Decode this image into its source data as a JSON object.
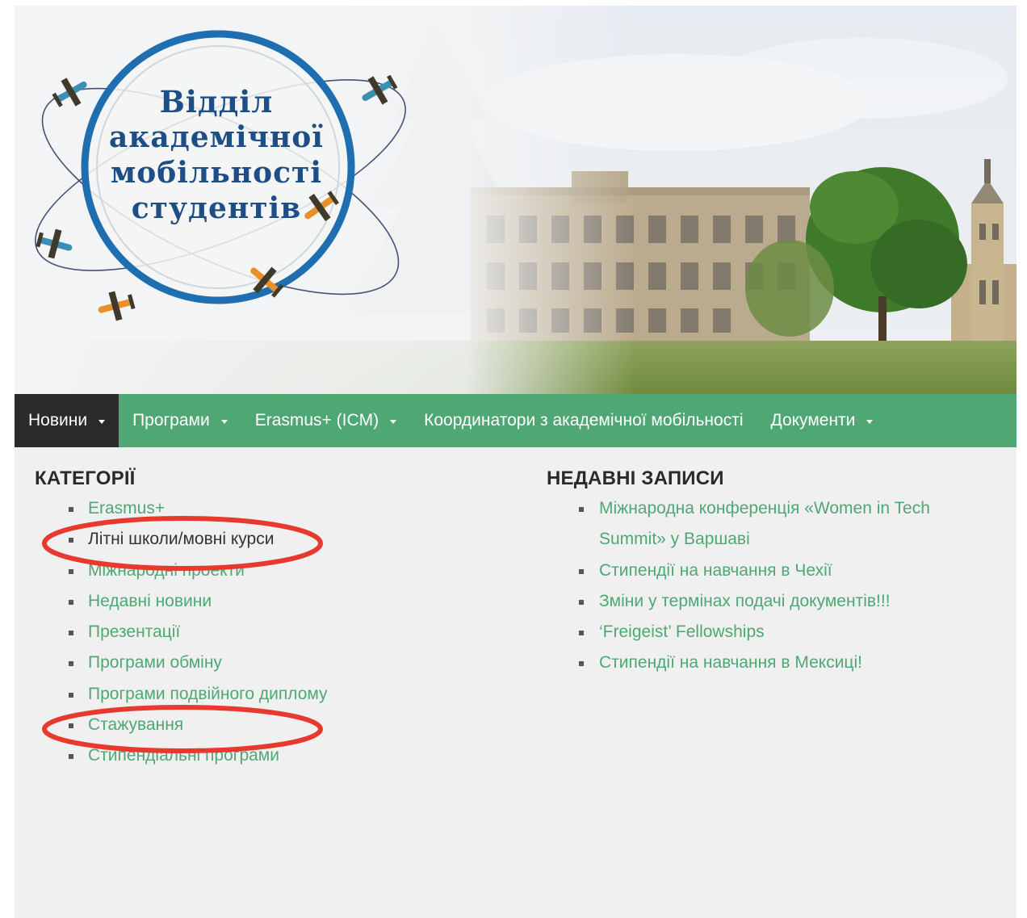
{
  "header": {
    "logo_lines": [
      "Відділ",
      "академічної",
      "мобільності",
      "студентів"
    ]
  },
  "nav": {
    "items": [
      {
        "label": "Новини",
        "has_dropdown": true,
        "active": true
      },
      {
        "label": "Програми",
        "has_dropdown": true,
        "active": false
      },
      {
        "label": "Erasmus+ (ICM)",
        "has_dropdown": true,
        "active": false
      },
      {
        "label": "Координатори з академічної мобільності",
        "has_dropdown": false,
        "active": false
      },
      {
        "label": "Документи",
        "has_dropdown": true,
        "active": false
      }
    ]
  },
  "categories": {
    "title": "КАТЕГОРІЇ",
    "items": [
      "Erasmus+",
      "Літні школи/мовні курси",
      "Міжнародні проекти",
      "Недавні новини",
      "Презентації",
      "Програми обміну",
      "Програми подвійного диплому",
      "Стажування",
      "Стипендіальні програми"
    ],
    "circled": [
      "Літні школи/мовні курси",
      "Стажування"
    ]
  },
  "recent": {
    "title": "НЕДАВНІ ЗАПИСИ",
    "items": [
      "Міжнародна конференція «Women in Tech Summit» у Варшаві",
      "Стипендії на навчання в Чехії",
      "Зміни у термінах подачі документів!!!",
      "‘Freigeist’ Fellowships",
      "Стипендії на навчання в Мексиці!"
    ]
  },
  "colors": {
    "nav_bg": "#4fa874",
    "nav_active": "#2b2b2b",
    "link": "#4fa874",
    "logo_ring": "#1f6fb0",
    "annotation": "#e8392e"
  }
}
